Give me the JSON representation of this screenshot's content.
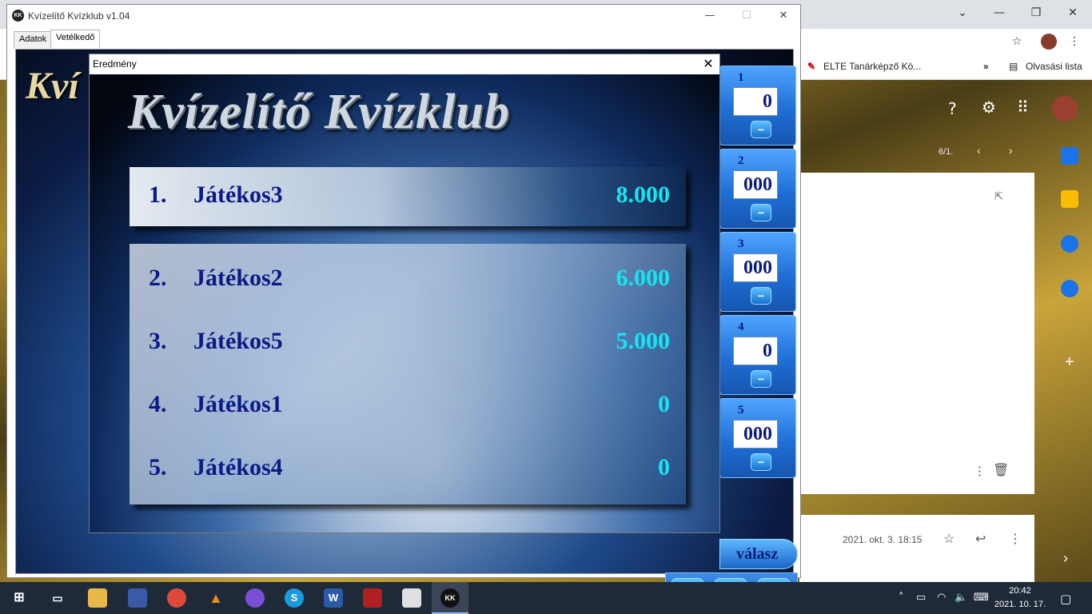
{
  "browser": {
    "bookmarks": {
      "elte": "ELTE Tanárképző Kö...",
      "more": "»",
      "reading_list": "Olvasási lista"
    },
    "gmail": {
      "pager": "6/1.",
      "date": "2021. okt. 3. 18:15"
    }
  },
  "app": {
    "title": "Kvízelítő Kvízklub v1.04",
    "logo_text": "KK",
    "tabs": [
      "Adatok",
      "Vetélkedő"
    ],
    "bg_logo": "Kví",
    "players": [
      {
        "num": "1",
        "score": "0"
      },
      {
        "num": "2",
        "score": "000"
      },
      {
        "num": "3",
        "score": "000"
      },
      {
        "num": "4",
        "score": "0"
      },
      {
        "num": "5",
        "score": "000"
      }
    ],
    "minus_label": "−",
    "answer_button": "válasz",
    "tools": {
      "help": "?",
      "lightning": "ϟ",
      "list": "☰"
    }
  },
  "dialog": {
    "title": "Eredmény",
    "heading": "Kvízelítő Kvízklub",
    "winner": {
      "rank": "1.",
      "name": "Játékos3",
      "score": "8.000"
    },
    "results": [
      {
        "rank": "2.",
        "name": "Játékos2",
        "score": "6.000"
      },
      {
        "rank": "3.",
        "name": "Játékos5",
        "score": "5.000"
      },
      {
        "rank": "4.",
        "name": "Játékos1",
        "score": "0"
      },
      {
        "rank": "5.",
        "name": "Játékos4",
        "score": "0"
      }
    ]
  },
  "taskbar": {
    "clock_time": "20:42",
    "clock_date": "2021. 10. 17.",
    "app_logo": "KK"
  }
}
